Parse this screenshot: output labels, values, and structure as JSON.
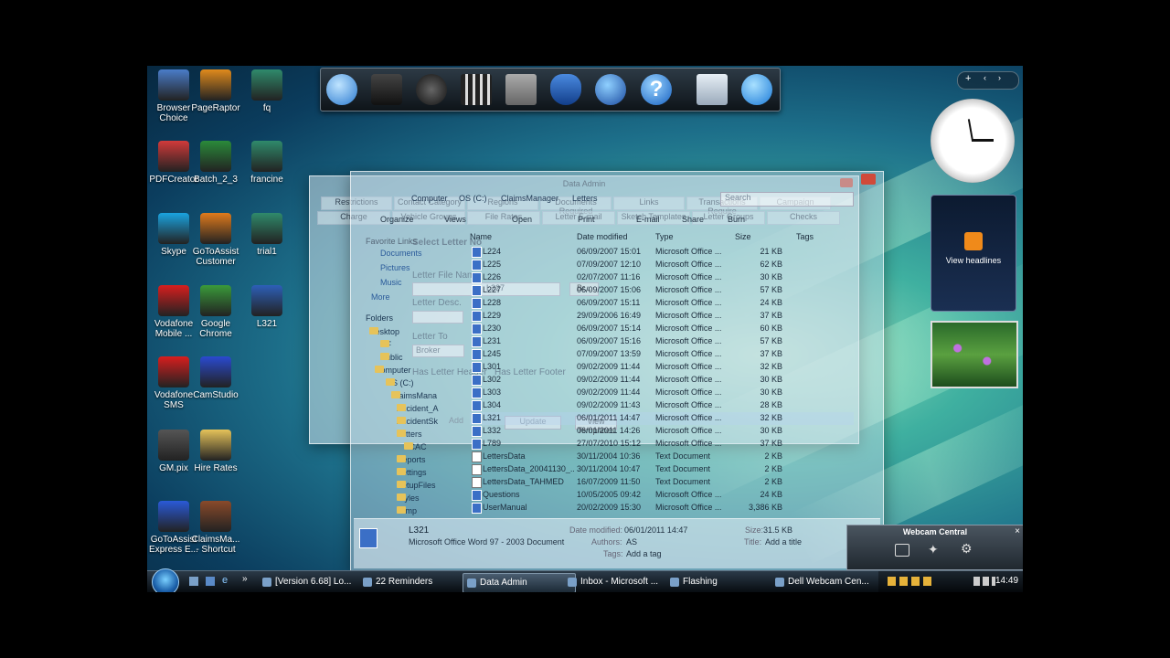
{
  "desktop_icons": [
    {
      "label": "Browser Choice",
      "color": "#4a7cc9"
    },
    {
      "label": "PageRaptor",
      "color": "#e08a1c"
    },
    {
      "label": "fq",
      "color": "#2f8a6b"
    },
    {
      "label": "PDFCreator",
      "color": "#d23a3a"
    },
    {
      "label": "Batch_2_3",
      "color": "#2a8a3a"
    },
    {
      "label": "francine",
      "color": "#2f8a6b"
    },
    {
      "label": "Skype",
      "color": "#1aa3e0"
    },
    {
      "label": "GoToAssist Customer",
      "color": "#e07a1c"
    },
    {
      "label": "trial1",
      "color": "#2f8a6b"
    },
    {
      "label": "Vodafone Mobile ...",
      "color": "#d81e1e"
    },
    {
      "label": "Google Chrome",
      "color": "#3a9a3a"
    },
    {
      "label": "L321",
      "color": "#2d5fb8"
    },
    {
      "label": "Vodafone SMS",
      "color": "#d81e1e"
    },
    {
      "label": "CamStudio",
      "color": "#2a4ad0"
    },
    {
      "label": "GM.pix",
      "color": "#555555"
    },
    {
      "label": "Hire Rates",
      "color": "#e6c35a"
    },
    {
      "label": "GoToAssist Express E...",
      "color": "#2a5ad8"
    },
    {
      "label": "ClaimsMa... - Shortcut",
      "color": "#8a4a2a"
    }
  ],
  "rss_gadget": {
    "label": "View headlines"
  },
  "window": {
    "title": "Data Admin",
    "tabs_row1": [
      "Restrictions",
      "Contact Category",
      "Regions",
      "Documents Required",
      "Links",
      "Transactions Require",
      "Campaign"
    ],
    "tabs_row2": [
      "Charge",
      "Vehicle Groups",
      "File Rates",
      "Letter E-mail",
      "Sketch Templates",
      "Letter Groups",
      "Checks"
    ],
    "form": {
      "select_letter_label": "Select Letter No",
      "file_name_label": "Letter File Name",
      "file_name_value": "L227",
      "browse_label": "Br...",
      "desc_label": "Letter Desc.",
      "letter_to_label": "Letter To",
      "letter_to_value": "Broker",
      "has_header_label": "Has Letter Header",
      "has_footer_label": "Has Letter Footer",
      "view_templates_label": "View Templates",
      "add_label": "Add",
      "update_label": "Update"
    }
  },
  "explorer": {
    "breadcrumb": [
      "Computer",
      "OS (C:)",
      "ClaimsManager",
      "Letters"
    ],
    "search_placeholder": "Search",
    "toolbar": [
      "Organize",
      "Views",
      "Open",
      "Print",
      "E-mail",
      "Share",
      "Burn"
    ],
    "favorite_links_label": "Favorite Links",
    "favorites": [
      "Documents",
      "Pictures",
      "Music",
      "More"
    ],
    "folders_label": "Folders",
    "tree": [
      "Desktop",
      "NF",
      "Public",
      "Computer",
      "OS (C:)",
      "ClaimsMana",
      "Accident_A",
      "AccidentSk",
      "Letters",
      "FCAC",
      "Reports",
      "Settings",
      "SetupFiles",
      "Styles",
      "Temp"
    ],
    "columns": [
      "Name",
      "Date modified",
      "Type",
      "Size",
      "Tags"
    ],
    "files": [
      {
        "name": "L224",
        "date": "06/09/2007 15:01",
        "type": "Microsoft Office ...",
        "size": "21 KB",
        "kind": "word"
      },
      {
        "name": "L225",
        "date": "07/09/2007 12:10",
        "type": "Microsoft Office ...",
        "size": "62 KB",
        "kind": "word"
      },
      {
        "name": "L226",
        "date": "02/07/2007 11:16",
        "type": "Microsoft Office ...",
        "size": "30 KB",
        "kind": "word"
      },
      {
        "name": "L227",
        "date": "06/09/2007 15:06",
        "type": "Microsoft Office ...",
        "size": "57 KB",
        "kind": "word"
      },
      {
        "name": "L228",
        "date": "06/09/2007 15:11",
        "type": "Microsoft Office ...",
        "size": "24 KB",
        "kind": "word"
      },
      {
        "name": "L229",
        "date": "29/09/2006 16:49",
        "type": "Microsoft Office ...",
        "size": "37 KB",
        "kind": "word"
      },
      {
        "name": "L230",
        "date": "06/09/2007 15:14",
        "type": "Microsoft Office ...",
        "size": "60 KB",
        "kind": "word"
      },
      {
        "name": "L231",
        "date": "06/09/2007 15:16",
        "type": "Microsoft Office ...",
        "size": "57 KB",
        "kind": "word"
      },
      {
        "name": "L245",
        "date": "07/09/2007 13:59",
        "type": "Microsoft Office ...",
        "size": "37 KB",
        "kind": "word"
      },
      {
        "name": "L301",
        "date": "09/02/2009 11:44",
        "type": "Microsoft Office ...",
        "size": "32 KB",
        "kind": "word"
      },
      {
        "name": "L302",
        "date": "09/02/2009 11:44",
        "type": "Microsoft Office ...",
        "size": "30 KB",
        "kind": "word"
      },
      {
        "name": "L303",
        "date": "09/02/2009 11:44",
        "type": "Microsoft Office ...",
        "size": "30 KB",
        "kind": "word"
      },
      {
        "name": "L304",
        "date": "09/02/2009 11:43",
        "type": "Microsoft Office ...",
        "size": "28 KB",
        "kind": "word"
      },
      {
        "name": "L321",
        "date": "06/01/2011 14:47",
        "type": "Microsoft Office ...",
        "size": "32 KB",
        "kind": "word"
      },
      {
        "name": "L332",
        "date": "06/01/2011 14:26",
        "type": "Microsoft Office ...",
        "size": "30 KB",
        "kind": "word"
      },
      {
        "name": "L789",
        "date": "27/07/2010 15:12",
        "type": "Microsoft Office ...",
        "size": "37 KB",
        "kind": "word"
      },
      {
        "name": "LettersData",
        "date": "30/11/2004 10:36",
        "type": "Text Document",
        "size": "2 KB",
        "kind": "txt"
      },
      {
        "name": "LettersData_20041130_...",
        "date": "30/11/2004 10:47",
        "type": "Text Document",
        "size": "2 KB",
        "kind": "txt"
      },
      {
        "name": "LettersData_TAHMED",
        "date": "16/07/2009 11:50",
        "type": "Text Document",
        "size": "2 KB",
        "kind": "txt"
      },
      {
        "name": "Questions",
        "date": "10/05/2005 09:42",
        "type": "Microsoft Office ...",
        "size": "24 KB",
        "kind": "word"
      },
      {
        "name": "UserManual",
        "date": "20/02/2009 15:30",
        "type": "Microsoft Office ...",
        "size": "3,386 KB",
        "kind": "word"
      }
    ],
    "details": {
      "name": "L321",
      "type": "Microsoft Office Word 97 - 2003 Document",
      "date_label": "Date modified:",
      "date_value": "06/01/2011 14:47",
      "authors_label": "Authors:",
      "authors_value": "AS",
      "tags_label": "Tags:",
      "tags_value": "Add a tag",
      "size_label": "Size:",
      "size_value": "31.5 KB",
      "title_label": "Title:",
      "title_value": "Add a title"
    }
  },
  "webcam": {
    "title": "Webcam Central"
  },
  "taskbar": {
    "items": [
      {
        "label": "[Version 6.68] Lo...",
        "active": false
      },
      {
        "label": "22 Reminders",
        "active": false
      },
      {
        "label": "Data Admin",
        "active": true
      },
      {
        "label": "Inbox - Microsoft ...",
        "active": false
      },
      {
        "label": "Flashing",
        "active": false
      },
      {
        "label": "Dell Webcam Cen...",
        "active": false
      }
    ],
    "clock": "14:49"
  },
  "colors": {
    "accent": "#1d6f8a",
    "taskbar": "#0a1118"
  }
}
